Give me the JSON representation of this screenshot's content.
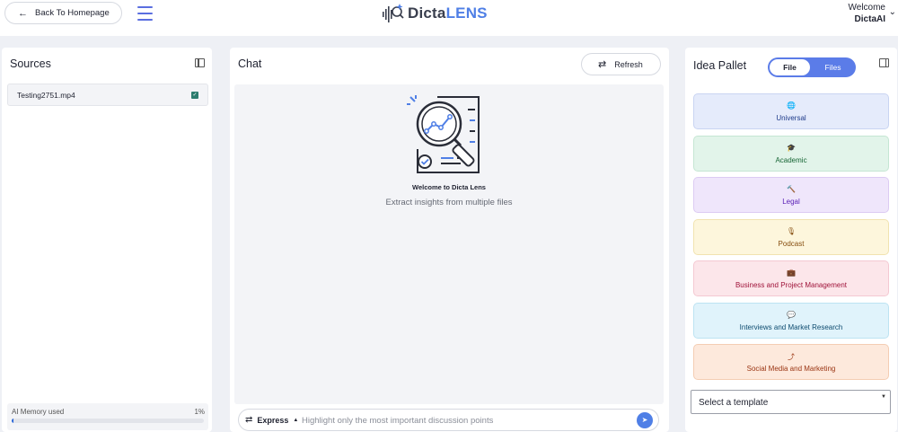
{
  "header": {
    "back_label": "Back To Homepage",
    "logo_part1": "Dicta",
    "logo_part2": "LENS",
    "welcome_line1": "Welcome",
    "welcome_user": "DictaAI"
  },
  "sources": {
    "title": "Sources",
    "files": [
      {
        "name": "Testing2751.mp4",
        "checked": true
      }
    ],
    "memory_label": "AI Memory used",
    "memory_percent_text": "1%",
    "memory_fraction": 0.01
  },
  "chat": {
    "title": "Chat",
    "refresh_label": "Refresh",
    "welcome_title": "Welcome to Dicta Lens",
    "welcome_subtitle": "Extract insights from multiple files",
    "mode_label": "Express",
    "input_placeholder": "Highlight only the most important discussion points"
  },
  "idea": {
    "title": "Idea Pallet",
    "toggle": {
      "file": "File",
      "files": "Files",
      "active": "File"
    },
    "categories": [
      {
        "label": "Universal",
        "icon": "globe-icon",
        "bg": "#e5ebfb",
        "border": "#c9d4f2",
        "color": "#1e3a8a"
      },
      {
        "label": "Academic",
        "icon": "graduation-cap-icon",
        "bg": "#e2f4ea",
        "border": "#c5e6d3",
        "color": "#166534"
      },
      {
        "label": "Legal",
        "icon": "gavel-icon",
        "bg": "#efe6fb",
        "border": "#dccbf3",
        "color": "#5b21b6"
      },
      {
        "label": "Podcast",
        "icon": "microphone-icon",
        "bg": "#fdf6dc",
        "border": "#f1e3b0",
        "color": "#854d0e"
      },
      {
        "label": "Business and Project Management",
        "icon": "briefcase-icon",
        "bg": "#fce6ea",
        "border": "#f4c9d2",
        "color": "#9f1239"
      },
      {
        "label": "Interviews and Market Research",
        "icon": "chat-bubbles-icon",
        "bg": "#e0f3fb",
        "border": "#bde3f2",
        "color": "#0c4a6e"
      },
      {
        "label": "Social Media and Marketing",
        "icon": "share-icon",
        "bg": "#fde9dc",
        "border": "#f4cdb3",
        "color": "#9a3412"
      }
    ],
    "template_placeholder": "Select a template"
  },
  "colors": {
    "accent": "#4f7fe6",
    "toggle_bg": "#5b7ce8",
    "checkbox": "#2d7d6f"
  }
}
